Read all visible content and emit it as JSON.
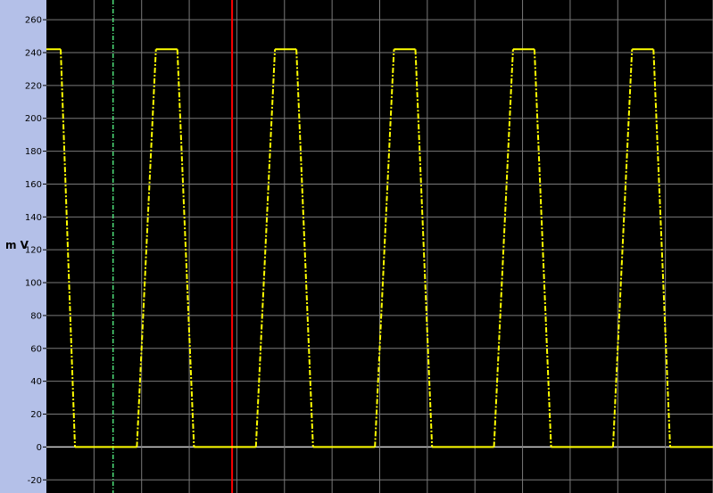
{
  "chart_data": {
    "type": "line",
    "ylabel": "m V",
    "ylim": [
      -28,
      272
    ],
    "y_ticks": [
      -20,
      0,
      20,
      40,
      60,
      80,
      100,
      120,
      140,
      160,
      180,
      200,
      220,
      240,
      260
    ],
    "grid": true,
    "x_tick_labels_shown": false,
    "series": [
      {
        "color": "#ffff00",
        "points": [
          [
            0,
            242
          ],
          [
            0.3,
            242
          ],
          [
            0.6,
            0
          ],
          [
            1.9,
            0
          ],
          [
            2.3,
            242
          ],
          [
            2.75,
            242
          ],
          [
            3.1,
            0
          ],
          [
            4.4,
            0
          ],
          [
            4.8,
            242
          ],
          [
            5.25,
            242
          ],
          [
            5.6,
            0
          ],
          [
            6.9,
            0
          ],
          [
            7.3,
            242
          ],
          [
            7.75,
            242
          ],
          [
            8.1,
            0
          ],
          [
            9.4,
            0
          ],
          [
            9.8,
            242
          ],
          [
            10.25,
            242
          ],
          [
            10.6,
            0
          ],
          [
            11.9,
            0
          ],
          [
            12.3,
            242
          ],
          [
            12.75,
            242
          ],
          [
            13.1,
            0
          ],
          [
            14.0,
            0
          ]
        ]
      }
    ],
    "cursors": [
      {
        "name": "green-cursor",
        "x": 1.4,
        "color": "#4ee07a",
        "style": "dashed"
      },
      {
        "name": "red-cursor",
        "x": 3.9,
        "color": "#ff0000",
        "style": "solid"
      }
    ],
    "colors": {
      "background": "#000000",
      "axis_panel": "#b4c0e8",
      "grid": "#7a7a7a",
      "zero_line": "#d0d0d0"
    }
  }
}
